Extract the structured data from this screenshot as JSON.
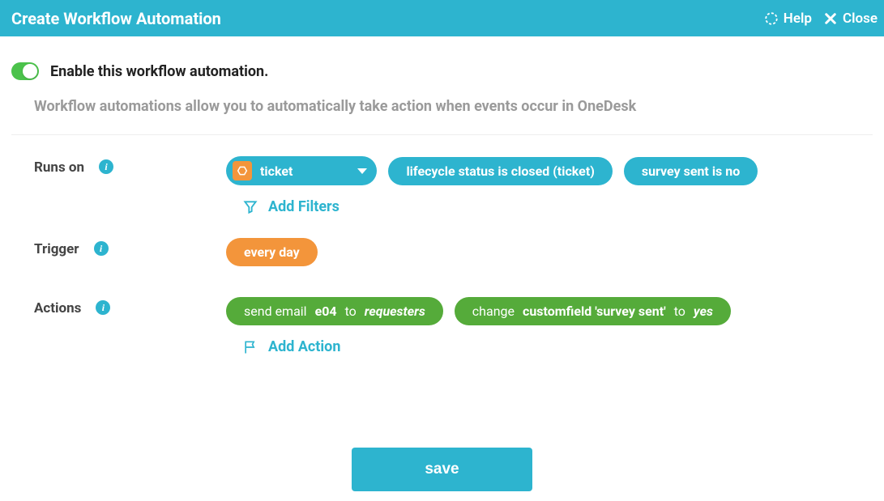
{
  "header": {
    "title": "Create Workflow Automation",
    "help": "Help",
    "close": "Close"
  },
  "enable": {
    "label": "Enable this workflow automation."
  },
  "description": "Workflow automations allow you to automatically take action when events occur in OneDesk",
  "sections": {
    "runsOn": {
      "label": "Runs on",
      "ticket": "ticket",
      "filter1": "lifecycle status is closed (ticket)",
      "filter2": "survey sent is no",
      "addFilters": "Add Filters"
    },
    "trigger": {
      "label": "Trigger",
      "value": "every day"
    },
    "actions": {
      "label": "Actions",
      "action1": {
        "prefix": "send email",
        "email": "e04",
        "mid": "to",
        "target": "requesters"
      },
      "action2": {
        "prefix": "change",
        "field": "customfield 'survey sent'",
        "mid": "to",
        "value": "yes"
      },
      "addAction": "Add Action"
    }
  },
  "save": "save"
}
